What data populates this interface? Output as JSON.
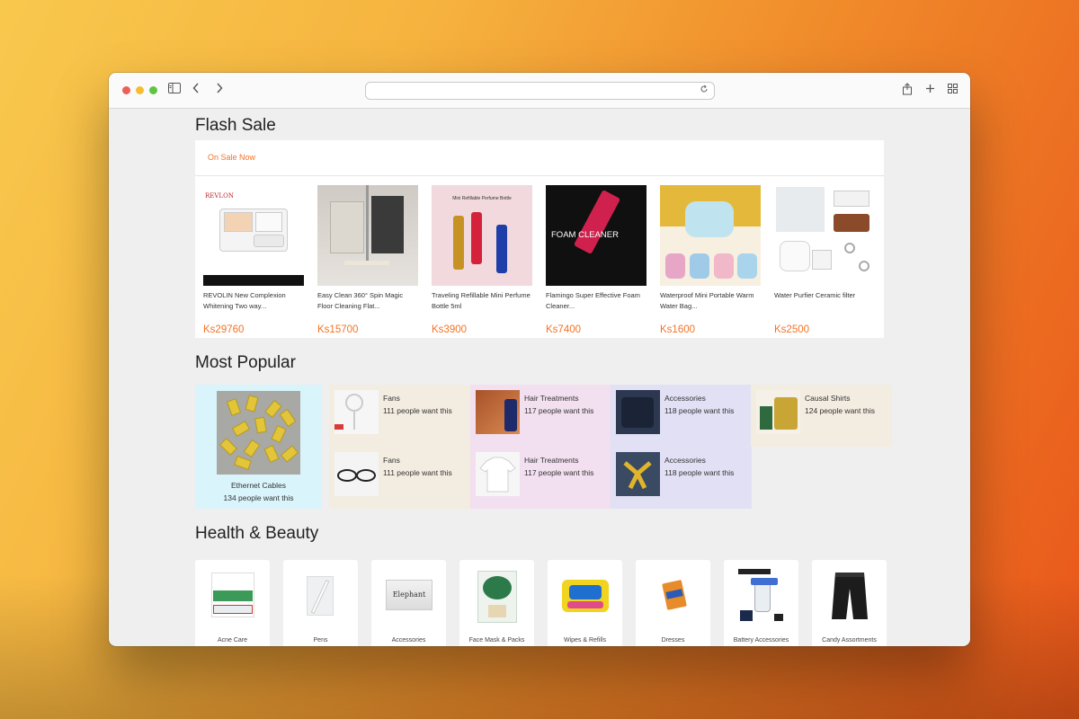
{
  "browser": {
    "address_value": "",
    "icons": [
      "sidebar-icon",
      "back-icon",
      "forward-icon",
      "reload-icon",
      "share-icon",
      "new-tab-icon",
      "tab-overview-icon"
    ]
  },
  "flash_sale": {
    "title": "Flash Sale",
    "status": "On Sale Now",
    "items": [
      {
        "name": "REVOLIN New Complexion Whitening Two way...",
        "price": "Ks29760"
      },
      {
        "name": "Easy Clean 360° Spin Magic Floor Cleaning Flat...",
        "price": "Ks15700"
      },
      {
        "name": "Traveling Refillable Mini Perfume Bottle 5ml",
        "price": "Ks3900"
      },
      {
        "name": "Flamingo Super Effective Foam Cleaner...",
        "price": "Ks7400"
      },
      {
        "name": "Waterproof Mini Portable Warm Water Bag...",
        "price": "Ks1600"
      },
      {
        "name": "Water Purfier Ceramic filter",
        "price": "Ks2500"
      }
    ],
    "image_text": {
      "revlon": "REVLON",
      "perfume_banner": "Mini Refillable Perfume Bottle",
      "foam": "FOAM CLEANER"
    }
  },
  "most_popular": {
    "title": "Most Popular",
    "featured": {
      "name": "Ethernet Cables",
      "count": "134 people want this"
    },
    "cells": [
      {
        "name": "Fans",
        "count": "111 people want this"
      },
      {
        "name": "Hair Treatments",
        "count": "117 people want this"
      },
      {
        "name": "Accessories",
        "count": "118 people want this"
      },
      {
        "name": "Causal Shirts",
        "count": "124 people want this"
      },
      {
        "name": "Fans",
        "count": "111 people want this"
      },
      {
        "name": "Hair Treatments",
        "count": "117 people want this"
      },
      {
        "name": "Accessories",
        "count": "118 people want this"
      }
    ]
  },
  "health_beauty": {
    "title": "Health & Beauty",
    "categories": [
      {
        "label": "Acne Care"
      },
      {
        "label": "Pens"
      },
      {
        "label": "Accessories",
        "image_text": "Elephant"
      },
      {
        "label": "Face Mask & Packs"
      },
      {
        "label": "Wipes & Refills"
      },
      {
        "label": "Dresses"
      },
      {
        "label": "Battery Accessories"
      },
      {
        "label": "Candy Assortments"
      }
    ]
  },
  "colors": {
    "accent": "#f57224",
    "pop_bg_cyan": "#d9f4fb",
    "pop_bg_beige": "#f3ece0",
    "pop_bg_pink": "#f2dff0",
    "pop_bg_lavender": "#e2e0f5"
  }
}
